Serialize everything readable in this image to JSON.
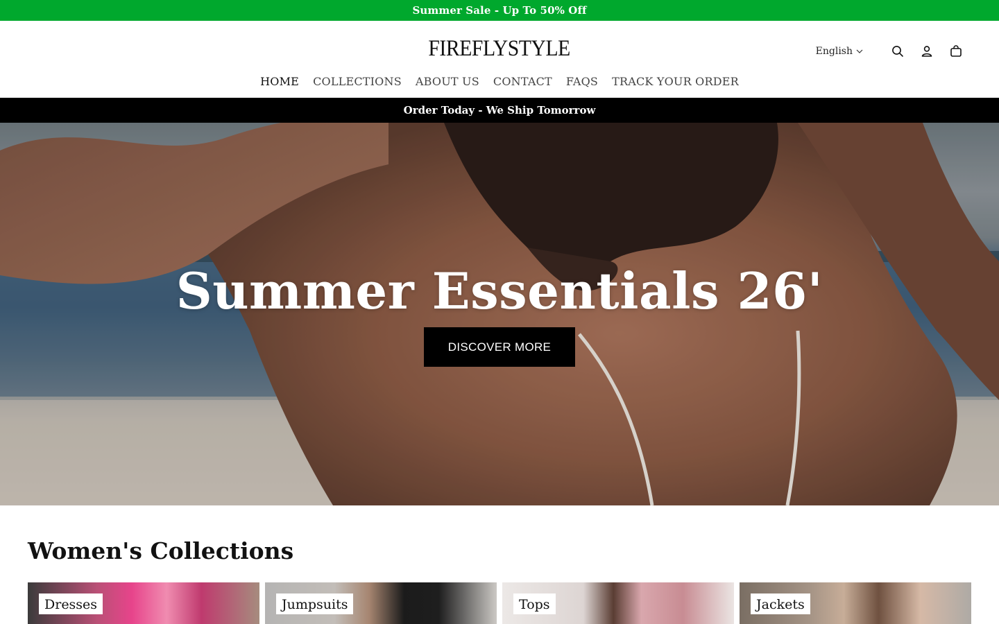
{
  "announcement": {
    "text": "Summer Sale - Up To 50% Off",
    "bg_color": "#00a82d"
  },
  "header": {
    "logo": "FIREFLYSTYLE",
    "language": "English",
    "icons": [
      "search-icon",
      "account-icon",
      "cart-icon"
    ]
  },
  "nav": {
    "items": [
      {
        "label": "HOME",
        "active": true
      },
      {
        "label": "COLLECTIONS",
        "active": false
      },
      {
        "label": "ABOUT US",
        "active": false
      },
      {
        "label": "CONTACT",
        "active": false
      },
      {
        "label": "FAQS",
        "active": false
      },
      {
        "label": "TRACK YOUR ORDER",
        "active": false
      }
    ]
  },
  "shipping_bar": {
    "text": "Order Today - We Ship Tomorrow"
  },
  "hero": {
    "title": "Summer Essentials 26'",
    "button_label": "DISCOVER MORE"
  },
  "collections": {
    "title": "Women's Collections",
    "cards": [
      {
        "label": "Dresses"
      },
      {
        "label": "Jumpsuits"
      },
      {
        "label": "Tops"
      },
      {
        "label": "Jackets"
      }
    ]
  }
}
